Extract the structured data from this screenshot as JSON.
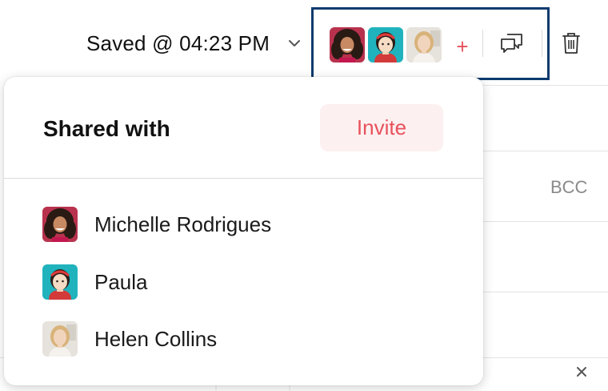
{
  "header": {
    "saved_status": "Saved @ 04:23 PM",
    "add_collaborator": "+"
  },
  "compose": {
    "bcc_label": "BCC"
  },
  "share_panel": {
    "title": "Shared with",
    "invite_label": "Invite",
    "members": [
      {
        "name": "Michelle Rodrigues",
        "avatar": "photo-avatar-dark-hair"
      },
      {
        "name": "Paula",
        "avatar": "cartoon-avatar-teal"
      },
      {
        "name": "Helen Collins",
        "avatar": "photo-avatar-blonde"
      }
    ]
  },
  "icons": [
    "chevron-down-icon",
    "plus-icon",
    "chat-icon",
    "trash-icon"
  ],
  "colors": {
    "accent": "#e8515c",
    "invite_bg": "#fdf0f0",
    "highlight_border": "#0d3b6e"
  }
}
